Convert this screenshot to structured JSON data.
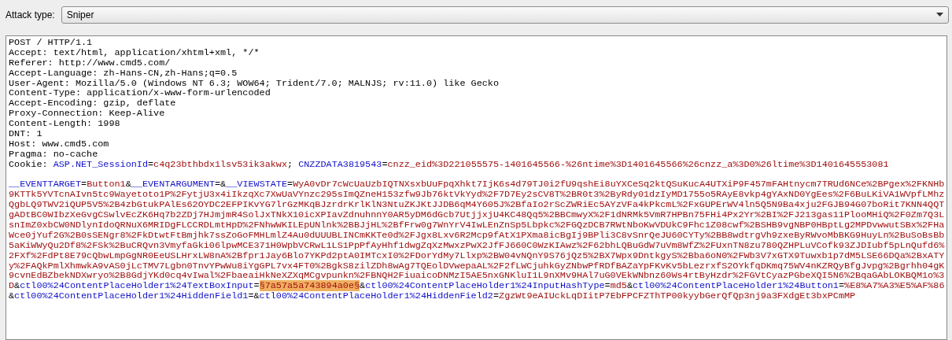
{
  "attack_type": {
    "label": "Attack type:",
    "value": "Sniper"
  },
  "request": {
    "headers": [
      [
        {
          "kind": "plain",
          "text": "POST / HTTP/1.1"
        }
      ],
      [
        {
          "kind": "plain",
          "text": "Accept: text/html, application/xhtml+xml, */*"
        }
      ],
      [
        {
          "kind": "plain",
          "text": "Referer: http://www.cmd5.com/"
        }
      ],
      [
        {
          "kind": "plain",
          "text": "Accept-Language: zh-Hans-CN,zh-Hans;q=0.5"
        }
      ],
      [
        {
          "kind": "plain",
          "text": "User-Agent: Mozilla/5.0 (Windows NT 6.3; WOW64; Trident/7.0; MALNJS; rv:11.0) like Gecko"
        }
      ],
      [
        {
          "kind": "plain",
          "text": "Content-Type: application/x-www-form-urlencoded"
        }
      ],
      [
        {
          "kind": "plain",
          "text": "Accept-Encoding: gzip, deflate"
        }
      ],
      [
        {
          "kind": "plain",
          "text": "Proxy-Connection: Keep-Alive"
        }
      ],
      [
        {
          "kind": "plain",
          "text": "Content-Length: 1998"
        }
      ],
      [
        {
          "kind": "plain",
          "text": "DNT: 1"
        }
      ],
      [
        {
          "kind": "plain",
          "text": "Host: www.cmd5.com"
        }
      ],
      [
        {
          "kind": "plain",
          "text": "Pragma: no-cache"
        }
      ],
      [
        {
          "kind": "plain",
          "text": "Cookie: "
        },
        {
          "kind": "name",
          "text": "ASP.NET_SessionId"
        },
        {
          "kind": "plain",
          "text": "="
        },
        {
          "kind": "value",
          "text": "c4q23bthbdx1lsv53ik3akwx"
        },
        {
          "kind": "plain",
          "text": "; "
        },
        {
          "kind": "name",
          "text": "CNZZDATA3819543"
        },
        {
          "kind": "plain",
          "text": "="
        },
        {
          "kind": "value",
          "text": "cnzz_eid%3D221055575-1401645566-%26ntime%3D1401645566%26cnzz_a%3D0%26ltime%3D1401645553081"
        }
      ]
    ],
    "body": [
      [
        {
          "kind": "name",
          "text": "__EVENTTARGET"
        },
        {
          "kind": "plain",
          "text": "="
        },
        {
          "kind": "value",
          "text": "Button1"
        },
        {
          "kind": "plain",
          "text": "&"
        },
        {
          "kind": "name",
          "text": "__EVENTARGUMENT"
        },
        {
          "kind": "plain",
          "text": "=&"
        },
        {
          "kind": "name",
          "text": "__VIEWSTATE"
        },
        {
          "kind": "plain",
          "text": "="
        },
        {
          "kind": "value",
          "text": "WyA0vDr7cWcUaUzbIQTNXsxbUuFpqXhkt7IjK6s4d79TJ0i2fU9qshEi8uYXCeSq2ktQSuKucA4UTXiP9F457mFAHtnycm7TRUd6NCe%2BPgex%2FKNHb"
        }
      ],
      [
        {
          "kind": "value",
          "text": "9KTTk5YVTcnAIvn5tc9Wayetoto1P%2FytjU3x4iIkzqXc7XwUaVYnzc295sImQZneH153zfw9Jb76ktVkYyd%2F7D7Ey2sCV8T%2BR0t3%2ByRdy01dzIyMD1755o5RAyE8vkp4gYAxND0YgEes%2F6BuLKiVA1WVpfLMhz"
        }
      ],
      [
        {
          "kind": "value",
          "text": "QgbLQ9TWV2iQUP5V5%2B4zbGtukPAlEs62OYDC2EFPIKvYG7lrGzMKqBJzrdrKrlKlN3NtuZKJKtJJDB6qM4Y605J%2BfaIo2rScZWRiEc5AYzVFa4kPkcmL%2FxGUPErWV4ln5Q5N9Ba4xju2FGJB94G07boRit7KNN4QQT"
        }
      ],
      [
        {
          "kind": "value",
          "text": "gADtBC0WIbzXeGvgCSwlvEcZK6Hq7b2ZDj7HJmjmR4SolJxTNkX10icXPIavZdnuhnnY0AR5yDM6dGcb7UtjjxjU4KC48Qq5%2BBCmwyX%2F1dNRMk5VmR7HPBn75FHi4Px2Yr%2BI%2FJ213gas11PlooMHiQ%2F0Zm7Q3L"
        }
      ],
      [
        {
          "kind": "value",
          "text": "snImZ0xbCW0NDlynIdoQRNuX6MRIDgFLCCRDLmtHpD%2FNhwWKILEpUNlnk%2BBJjHL%2BfFrw0g7WnYrV4IwLEnZnSp5Lbpkc%2FGQzDCB7RWtNboKwVDUkC9Fhc1Z08cwf%2BSHB9vgNBP0HBptLg2MPDvwwutSBx%2FHa"
        }
      ],
      [
        {
          "kind": "value",
          "text": "Wce0jYuf2G%2B0sSENgr8%2FkDtwtFtBmjhk7ssZoGoFMHLmlZ4Au0dUUUBLINCmKKTe0d%2FJgx8Lxv6R2Mcp9fAtX1PXma8icBgIj9BPli3C8vSnrQeJU60CYTy%2BB8wdtrgVh9zxeByRWvoMbBKG9HuyLn%2BuSoBsBb"
        }
      ],
      [
        {
          "kind": "value",
          "text": "5aKiWWyQu2Df8%2FSk%2BuCRQvn3VmyfaGki06lpwMCE371H0WpbVCRwL1LS1PpPfAyHhf1dwgZqXzMwxzPwX2JfFJ660C0WzKIAwz%2F62bhLQBuGdW7uVm8WfZ%2FUxnTN8zu780QZHPLuVCofk93ZJDIubf5pLnQufd6%"
        }
      ],
      [
        {
          "kind": "value",
          "text": "2FXf%2FdPt8E79cQbwLmpGgNR0EeUSLHrxLW8nA%2Bfpr1Jay6Blo7YKPd2ptA0IMTcxI0%2FDorYdMy7Llxp%2BW04vNQnY9S76jQz5%2BX7Wpx9DntkgyS%2Bba6oN0%2FWb3V7xGTX9Tuwxb1p7dM5LSE66DQa%2BxATY"
        }
      ],
      [
        {
          "kind": "value",
          "text": "y%2FAQkPmlXhmwkA9vAS0jLcTMV7Lgbn0TnvYPwWu8iYgGPL7vx4FT0%2BgkS8zilZDh8wAg7TQEolDVwepaAL%2F2fLWCjuhkGyZNbwPfRDfBAZaYpFKvKv5bLezrxfS2OYkfqDKmq75WV4nKZRQyBfgJvpg%2Bgrhh04gK"
        }
      ],
      [
        {
          "kind": "value",
          "text": "9cvnEdBZbekNDXwryo%2B8GdjYKd0cq4vIwal%2FbaeaiHkNeXZXqMCgvpunkn%2FBNQH2FiuaicoDNMzI5AE5nxGNKluI1L9nXMv9HAl7uG0VEkWNbnz60Ws4rtByHzdr%2FGVtCyazPGbeXQI5N6%2BqaGAbLOKBQM1o%3"
        }
      ],
      [
        {
          "kind": "value",
          "text": "D"
        },
        {
          "kind": "plain",
          "text": "&"
        },
        {
          "kind": "name",
          "text": "ctl00%24ContentPlaceHolder1%24TextBoxInput"
        },
        {
          "kind": "plain",
          "text": "="
        },
        {
          "kind": "payload",
          "text": "§7a57a5a743894a0e§"
        },
        {
          "kind": "plain",
          "text": "&"
        },
        {
          "kind": "name",
          "text": "ctl00%24ContentPlaceHolder1%24InputHashType"
        },
        {
          "kind": "plain",
          "text": "="
        },
        {
          "kind": "value",
          "text": "md5"
        },
        {
          "kind": "plain",
          "text": "&"
        },
        {
          "kind": "name",
          "text": "ctl00%24ContentPlaceHolder1%24Button1"
        },
        {
          "kind": "plain",
          "text": "="
        },
        {
          "kind": "value",
          "text": "%E8%A7%A3%E5%AF%86"
        }
      ],
      [
        {
          "kind": "plain",
          "text": "&"
        },
        {
          "kind": "name",
          "text": "ctl00%24ContentPlaceHolder1%24HiddenField1"
        },
        {
          "kind": "plain",
          "text": "=&"
        },
        {
          "kind": "name",
          "text": "ctl00%24ContentPlaceHolder1%24HiddenField2"
        },
        {
          "kind": "plain",
          "text": "="
        },
        {
          "kind": "value",
          "text": "ZgzWt9eAIUckLqDIitP7EbFPCFZThTP00kyybGerQfQp3nj9a3FXdgEt3bxPCmMP"
        }
      ]
    ]
  }
}
